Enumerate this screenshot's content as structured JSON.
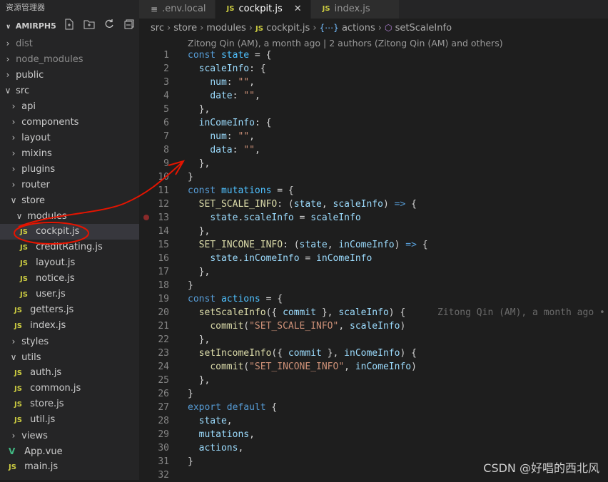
{
  "sidebar": {
    "title": "资源管理器",
    "project": "AMIRPH5",
    "items": [
      {
        "label": "dist",
        "dim": true
      },
      {
        "label": "node_modules",
        "dim": true
      },
      {
        "label": "public"
      },
      {
        "label": "src"
      },
      {
        "label": "api"
      },
      {
        "label": "components"
      },
      {
        "label": "layout"
      },
      {
        "label": "mixins"
      },
      {
        "label": "plugins"
      },
      {
        "label": "router"
      },
      {
        "label": "store"
      },
      {
        "label": "modules"
      },
      {
        "label": "cockpit.js"
      },
      {
        "label": "creditRating.js"
      },
      {
        "label": "layout.js"
      },
      {
        "label": "notice.js"
      },
      {
        "label": "user.js"
      },
      {
        "label": "getters.js"
      },
      {
        "label": "index.js"
      },
      {
        "label": "styles"
      },
      {
        "label": "utils"
      },
      {
        "label": "auth.js"
      },
      {
        "label": "common.js"
      },
      {
        "label": "store.js"
      },
      {
        "label": "util.js"
      },
      {
        "label": "views"
      },
      {
        "label": "App.vue"
      },
      {
        "label": "main.js"
      }
    ]
  },
  "tabs": [
    {
      "icon": "≡",
      "label": ".env.local"
    },
    {
      "icon": "JS",
      "label": "cockpit.js",
      "active": true
    },
    {
      "icon": "JS",
      "label": "index.js"
    }
  ],
  "breadcrumb": {
    "src": "src",
    "store": "store",
    "modules": "modules",
    "file": "cockpit.js",
    "actions": "actions",
    "fn": "setScaleInfo"
  },
  "blame_header": "Zitong Qin (AM), a month ago | 2 authors (Zitong Qin (AM) and others)",
  "inline_blame": "Zitong Qin (AM), a month ago •",
  "line_numbers": [
    "1",
    "2",
    "3",
    "4",
    "5",
    "6",
    "7",
    "8",
    "9",
    "10",
    "11",
    "12",
    "13",
    "14",
    "15",
    "16",
    "17",
    "18",
    "19",
    "20",
    "21",
    "22",
    "23",
    "24",
    "25",
    "26",
    "27",
    "28",
    "29",
    "30",
    "31",
    "32"
  ],
  "watermark": "CSDN @好唱的西北风",
  "colors": {
    "background": "#1e1e1e",
    "sidebar": "#252526",
    "keyword": "#569cd6",
    "string": "#ce9178",
    "annotation": "#e51400"
  }
}
